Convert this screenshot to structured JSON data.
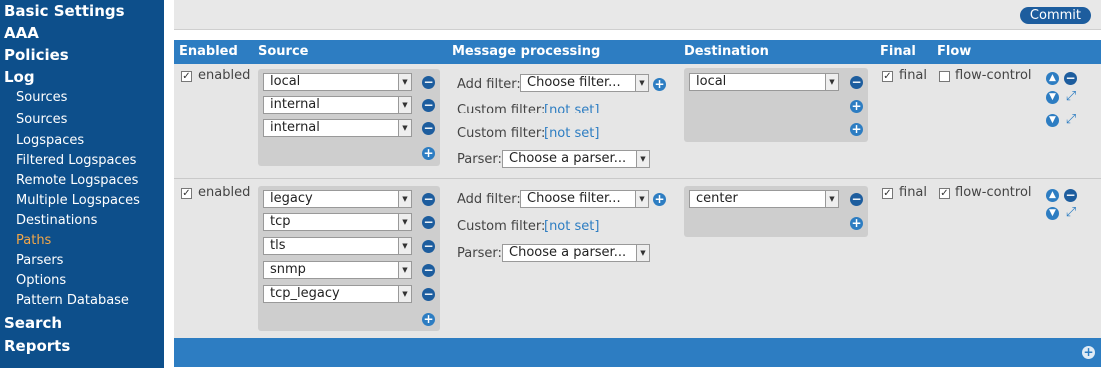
{
  "sidebar": {
    "basic_settings": "Basic Settings",
    "aaa": "AAA",
    "policies": "Policies",
    "log": "Log",
    "log_items": [
      "Sources",
      "Sources",
      "Logspaces",
      "Filtered Logspaces",
      "Remote Logspaces",
      "Multiple Logspaces",
      "Destinations",
      "Paths",
      "Parsers",
      "Options",
      "Pattern Database"
    ],
    "active_item": "Paths",
    "search": "Search",
    "reports": "Reports"
  },
  "toolbar": {
    "commit_label": "Commit"
  },
  "table": {
    "headers": {
      "enabled": "Enabled",
      "source": "Source",
      "message_processing": "Message processing",
      "destination": "Destination",
      "final": "Final",
      "flow": "Flow"
    }
  },
  "rows": [
    {
      "enabled_label": "enabled",
      "enabled_checked": true,
      "sources": [
        "local",
        "internal",
        "internal"
      ],
      "add_filter_label": "Add filter:",
      "filter_select": "Choose filter...",
      "custom_filter_label": "Custom filter:",
      "custom_filter_value": "[not set]",
      "parser_label": "Parser:",
      "parser_select": "Choose a parser...",
      "destinations": [
        "local"
      ],
      "final_label": "final",
      "final_checked": true,
      "flow_label": "flow-control",
      "flow_checked": false
    },
    {
      "enabled_label": "enabled",
      "enabled_checked": true,
      "sources": [
        "legacy",
        "tcp",
        "tls",
        "snmp",
        "tcp_legacy"
      ],
      "add_filter_label": "Add filter:",
      "filter_select": "Choose filter...",
      "custom_filter_label": "Custom filter:",
      "custom_filter_value": "[not set]",
      "parser_label": "Parser:",
      "parser_select": "Choose a parser...",
      "destinations": [
        "center"
      ],
      "final_label": "final",
      "final_checked": true,
      "flow_label": "flow-control",
      "flow_checked": true
    }
  ],
  "icons": {
    "remove": "minus-circle-icon",
    "add": "plus-circle-icon",
    "up": "arrow-up-icon",
    "down": "arrow-down-icon",
    "expand": "expand-icon",
    "dropdown": "triangle-down-icon"
  },
  "colors": {
    "sidebar_bg": "#0d4f8b",
    "header_bg": "#2d7dc2",
    "active_nav": "#f0a64a",
    "link": "#2d7dc2"
  }
}
